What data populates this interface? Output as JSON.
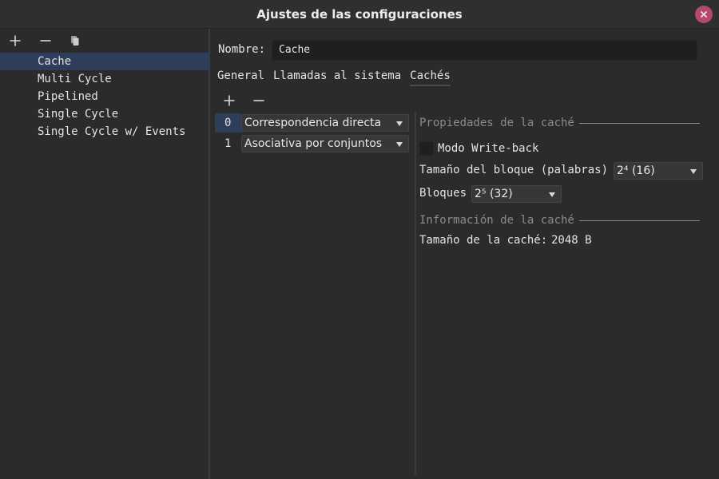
{
  "window": {
    "title": "Ajustes de las configuraciones",
    "close_icon": "close-icon"
  },
  "colors": {
    "background": "#2b2b2b",
    "selection": "#2e3e5a",
    "close_button": "#b4496e"
  },
  "left_toolbar": {
    "icons": [
      "add-icon",
      "remove-icon",
      "copy-icon"
    ]
  },
  "configurations": [
    {
      "label": "Cache",
      "selected": true
    },
    {
      "label": "Multi Cycle",
      "selected": false
    },
    {
      "label": "Pipelined",
      "selected": false
    },
    {
      "label": "Single Cycle",
      "selected": false
    },
    {
      "label": "Single Cycle w/ Events",
      "selected": false
    }
  ],
  "name_field": {
    "label": "Nombre:",
    "value": "Cache"
  },
  "tabs": [
    {
      "label": "General",
      "active": false
    },
    {
      "label": "Llamadas al sistema",
      "active": false
    },
    {
      "label": "Cachés",
      "active": true
    }
  ],
  "cache_toolbar": {
    "icons": [
      "add-icon",
      "remove-icon"
    ]
  },
  "caches": [
    {
      "index": "0",
      "type": "Correspondencia directa",
      "selected": true
    },
    {
      "index": "1",
      "type": "Asociativa por conjuntos",
      "selected": false
    }
  ],
  "properties": {
    "header": "Propiedades de la caché",
    "writeback_label": "Modo Write-back",
    "writeback_checked": false,
    "block_size_label": "Tamaño del bloque (palabras)",
    "block_size_value": "2⁴ (16)",
    "blocks_label": "Bloques",
    "blocks_value": "2⁵ (32)"
  },
  "info": {
    "header": "Información de la caché",
    "size_label": "Tamaño de la caché:",
    "size_value": "2048 B"
  }
}
